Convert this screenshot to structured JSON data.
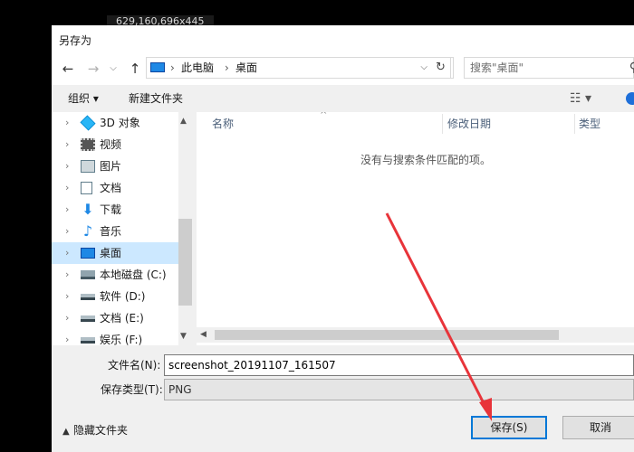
{
  "overlay_coords": "629,160,696x445",
  "dialog": {
    "title": "另存为"
  },
  "address": {
    "crumbs": [
      "此电脑",
      "桌面"
    ],
    "search_placeholder": "搜索\"桌面\""
  },
  "toolbar": {
    "organize": "组织 ▾",
    "new_folder": "新建文件夹"
  },
  "tree": [
    {
      "label": "3D 对象",
      "icon": "3d-objects-icon",
      "selected": false
    },
    {
      "label": "视频",
      "icon": "video-icon",
      "selected": false
    },
    {
      "label": "图片",
      "icon": "pictures-icon",
      "selected": false
    },
    {
      "label": "文档",
      "icon": "documents-icon",
      "selected": false
    },
    {
      "label": "下载",
      "icon": "download-icon",
      "selected": false
    },
    {
      "label": "音乐",
      "icon": "music-icon",
      "selected": false
    },
    {
      "label": "桌面",
      "icon": "desktop-icon",
      "selected": true
    },
    {
      "label": "本地磁盘 (C:)",
      "icon": "local-disk-icon",
      "selected": false
    },
    {
      "label": "软件 (D:)",
      "icon": "drive-icon",
      "selected": false
    },
    {
      "label": "文档 (E:)",
      "icon": "drive-icon",
      "selected": false
    },
    {
      "label": "娱乐 (F:)",
      "icon": "drive-icon",
      "selected": false
    }
  ],
  "columns": {
    "name": "名称",
    "modified": "修改日期",
    "type": "类型"
  },
  "empty_message": "没有与搜索条件匹配的项。",
  "form": {
    "filename_label": "文件名(N):",
    "filename_value": "screenshot_20191107_161507",
    "filetype_label": "保存类型(T):",
    "filetype_value": "PNG"
  },
  "footer": {
    "hide_folders": "隐藏文件夹",
    "save": "保存(S)",
    "cancel": "取消"
  },
  "colors": {
    "selection": "#cce8ff",
    "accent": "#0078d7",
    "annotation_arrow": "#e8343a"
  }
}
